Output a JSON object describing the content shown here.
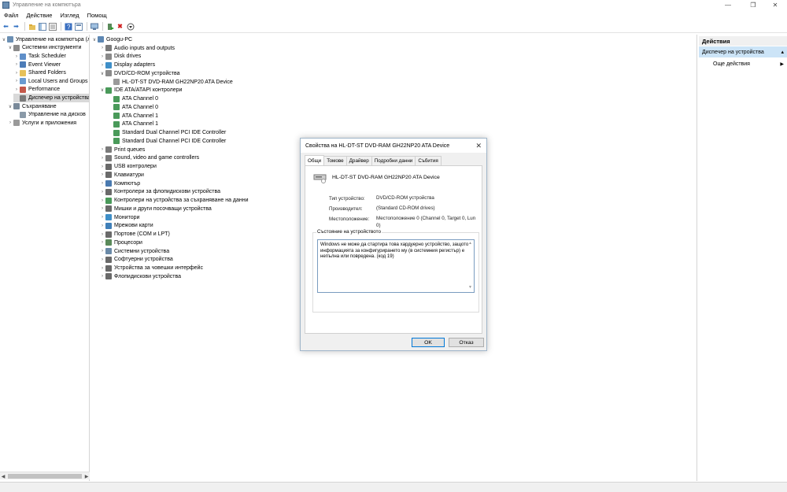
{
  "window": {
    "title": "Управление на компютъра",
    "minimize": "—",
    "restore": "❐",
    "close": "✕"
  },
  "menu": [
    "Файл",
    "Действие",
    "Изглед",
    "Помощ"
  ],
  "left_tree": [
    {
      "label": "Управление на компютъра (л",
      "indent": 0,
      "arrow": "∨",
      "icon": "computer-management-icon",
      "color": "#6b8fb3"
    },
    {
      "label": "Системни инструменти",
      "indent": 1,
      "arrow": "∨",
      "icon": "system-tools-icon",
      "color": "#8a8a8a"
    },
    {
      "label": "Task Scheduler",
      "indent": 2,
      "arrow": "›",
      "icon": "clock-icon",
      "color": "#5f8fc9"
    },
    {
      "label": "Event Viewer",
      "indent": 2,
      "arrow": "›",
      "icon": "event-viewer-icon",
      "color": "#4d7db8"
    },
    {
      "label": "Shared Folders",
      "indent": 2,
      "arrow": "›",
      "icon": "folder-icon",
      "color": "#e6c15a"
    },
    {
      "label": "Local Users and Groups",
      "indent": 2,
      "arrow": "›",
      "icon": "users-icon",
      "color": "#6a9bd1"
    },
    {
      "label": "Performance",
      "indent": 2,
      "arrow": "›",
      "icon": "performance-icon",
      "color": "#c4584a"
    },
    {
      "label": "Диспечер на устройства",
      "indent": 2,
      "arrow": "",
      "icon": "device-manager-icon",
      "color": "#7a7a7a",
      "selected": true
    },
    {
      "label": "Съхраняване",
      "indent": 1,
      "arrow": "∨",
      "icon": "storage-icon",
      "color": "#7a8a9a"
    },
    {
      "label": "Управление на дисков",
      "indent": 2,
      "arrow": "",
      "icon": "disk-management-icon",
      "color": "#8a9aa8"
    },
    {
      "label": "Услуги и приложения",
      "indent": 1,
      "arrow": "›",
      "icon": "services-icon",
      "color": "#9a9a9a"
    }
  ],
  "device_tree": [
    {
      "label": "Googu-PC",
      "indent": 0,
      "arrow": "∨",
      "icon": "computer-icon",
      "color": "#5d87b3"
    },
    {
      "label": "Audio inputs and outputs",
      "indent": 1,
      "arrow": "›",
      "icon": "speaker-icon",
      "color": "#7a7a7a"
    },
    {
      "label": "Disk drives",
      "indent": 1,
      "arrow": "›",
      "icon": "disk-drive-icon",
      "color": "#8a8a8a"
    },
    {
      "label": "Display adapters",
      "indent": 1,
      "arrow": "›",
      "icon": "display-adapter-icon",
      "color": "#3f8fc8"
    },
    {
      "label": "DVD/CD-ROM устройства",
      "indent": 1,
      "arrow": "∨",
      "icon": "dvd-drive-icon",
      "color": "#8a8a8a"
    },
    {
      "label": "HL-DT-ST DVD-RAM GH22NP20 ATA Device",
      "indent": 2,
      "arrow": "",
      "icon": "dvd-warning-icon",
      "color": "#9a9a9a"
    },
    {
      "label": "IDE ATA/ATAPI контролери",
      "indent": 1,
      "arrow": "∨",
      "icon": "ide-controller-icon",
      "color": "#4a9a5a"
    },
    {
      "label": "ATA Channel 0",
      "indent": 2,
      "arrow": "",
      "icon": "ide-channel-icon",
      "color": "#4a9a5a"
    },
    {
      "label": "ATA Channel 0",
      "indent": 2,
      "arrow": "",
      "icon": "ide-channel-icon",
      "color": "#4a9a5a"
    },
    {
      "label": "ATA Channel 1",
      "indent": 2,
      "arrow": "",
      "icon": "ide-channel-icon",
      "color": "#4a9a5a"
    },
    {
      "label": "ATA Channel 1",
      "indent": 2,
      "arrow": "",
      "icon": "ide-channel-icon",
      "color": "#4a9a5a"
    },
    {
      "label": "Standard Dual Channel PCI IDE Controller",
      "indent": 2,
      "arrow": "",
      "icon": "ide-channel-icon",
      "color": "#4a9a5a"
    },
    {
      "label": "Standard Dual Channel PCI IDE Controller",
      "indent": 2,
      "arrow": "",
      "icon": "ide-channel-icon",
      "color": "#4a9a5a"
    },
    {
      "label": "Print queues",
      "indent": 1,
      "arrow": "›",
      "icon": "printer-icon",
      "color": "#7a7a7a"
    },
    {
      "label": "Sound, video and game controllers",
      "indent": 1,
      "arrow": "›",
      "icon": "sound-icon",
      "color": "#7a7a7a"
    },
    {
      "label": "USB контролери",
      "indent": 1,
      "arrow": "›",
      "icon": "usb-icon",
      "color": "#6a6a6a"
    },
    {
      "label": "Клавиатури",
      "indent": 1,
      "arrow": "›",
      "icon": "keyboard-icon",
      "color": "#6a6a6a"
    },
    {
      "label": "Компютър",
      "indent": 1,
      "arrow": "›",
      "icon": "computer-icon",
      "color": "#4a7ab0"
    },
    {
      "label": "Контролери за флопидискови устройства",
      "indent": 1,
      "arrow": "›",
      "icon": "floppy-controller-icon",
      "color": "#6a6a6a"
    },
    {
      "label": "Контролери на устройства за съхраняване на данни",
      "indent": 1,
      "arrow": "›",
      "icon": "storage-controller-icon",
      "color": "#4a9a5a"
    },
    {
      "label": "Мишки и други посочващи устройства",
      "indent": 1,
      "arrow": "›",
      "icon": "mouse-icon",
      "color": "#6a6a6a"
    },
    {
      "label": "Монитори",
      "indent": 1,
      "arrow": "›",
      "icon": "monitor-icon",
      "color": "#3f8fc8"
    },
    {
      "label": "Мрежови карти",
      "indent": 1,
      "arrow": "›",
      "icon": "network-adapter-icon",
      "color": "#3f7fb8"
    },
    {
      "label": "Портове (COM и LPT)",
      "indent": 1,
      "arrow": "›",
      "icon": "port-icon",
      "color": "#6a6a6a"
    },
    {
      "label": "Процесори",
      "indent": 1,
      "arrow": "›",
      "icon": "processor-icon",
      "color": "#5a8a5a"
    },
    {
      "label": "Системни устройства",
      "indent": 1,
      "arrow": "›",
      "icon": "system-device-icon",
      "color": "#6a8aa8"
    },
    {
      "label": "Софтуерни устройства",
      "indent": 1,
      "arrow": "›",
      "icon": "software-device-icon",
      "color": "#6a6a6a"
    },
    {
      "label": "Устройства за човешки интерфейс",
      "indent": 1,
      "arrow": "›",
      "icon": "hid-icon",
      "color": "#6a6a6a"
    },
    {
      "label": "Флопидискови устройства",
      "indent": 1,
      "arrow": "›",
      "icon": "floppy-drive-icon",
      "color": "#6a6a6a"
    }
  ],
  "actions": {
    "header": "Действия",
    "selected": "Диспечер на устройства",
    "more": "Още действия"
  },
  "dialog": {
    "title": "Свойства на HL-DT-ST DVD-RAM GH22NP20 ATA Device",
    "tabs": [
      "Общи",
      "Томове",
      "Драйвер",
      "Подробни данни",
      "Събития"
    ],
    "device_name": "HL-DT-ST DVD-RAM GH22NP20 ATA Device",
    "props": [
      {
        "label": "Тип устройство:",
        "value": "DVD/CD-ROM устройства"
      },
      {
        "label": "Производител:",
        "value": "(Standard CD-ROM drives)"
      },
      {
        "label": "Местоположение:",
        "value": "Местоположение 0 (Channel 0, Target 0, Lun 0)"
      }
    ],
    "status_legend": "Състояние на устройството",
    "status_text": "Windows не може да стартира това хардуерно устройство, защото информацията за конфигурирането му (в системния регистър) е непълна или повредена. (код 19)",
    "ok": "OK",
    "cancel": "Отказ"
  }
}
